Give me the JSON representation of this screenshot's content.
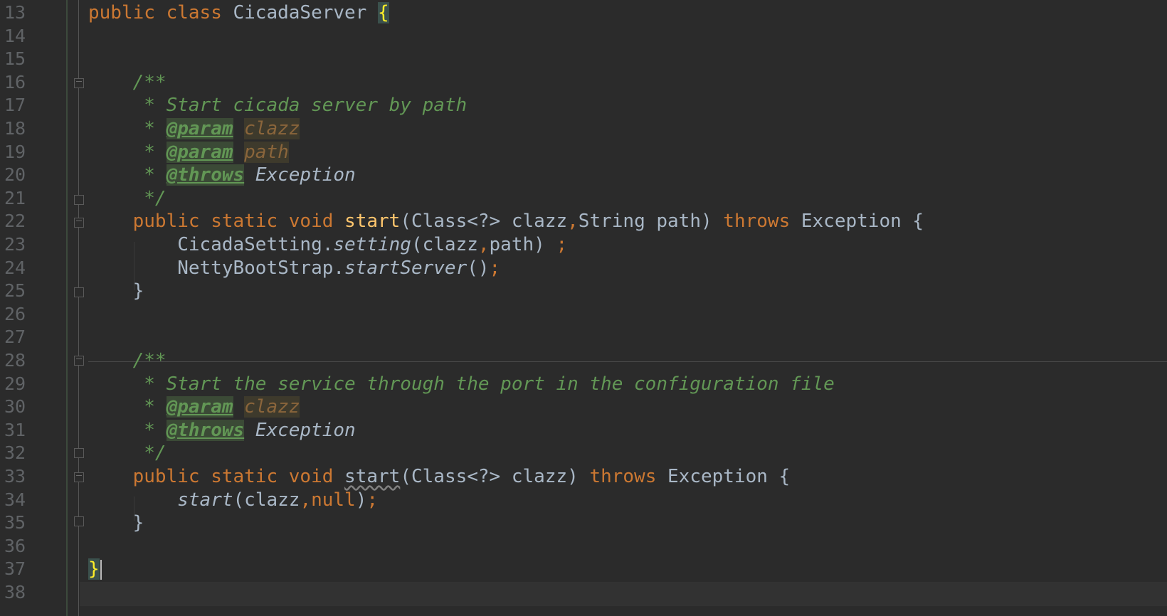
{
  "colors": {
    "background": "#2b2b2b",
    "keyword": "#cc7832",
    "plain": "#a9b7c6",
    "function_decl": "#ffc66d",
    "doc_comment": "#629755",
    "line_number": "#606366"
  },
  "editor": {
    "lines": [
      {
        "num": "13",
        "tokens": [
          {
            "t": "public ",
            "c": "kw"
          },
          {
            "t": "class ",
            "c": "kw"
          },
          {
            "t": "CicadaServer ",
            "c": "cls"
          },
          {
            "t": "{",
            "c": "brace-hl"
          }
        ]
      },
      {
        "num": "14",
        "tokens": []
      },
      {
        "num": "15",
        "tokens": []
      },
      {
        "num": "16",
        "tokens": [
          {
            "t": "    /**",
            "c": "doc"
          }
        ]
      },
      {
        "num": "17",
        "tokens": [
          {
            "t": "     * Start cicada server by path",
            "c": "doc"
          }
        ]
      },
      {
        "num": "18",
        "tokens": [
          {
            "t": "     * ",
            "c": "doc"
          },
          {
            "t": "@param",
            "c": "doctag"
          },
          {
            "t": " ",
            "c": "doc"
          },
          {
            "t": "clazz",
            "c": "docparam"
          }
        ]
      },
      {
        "num": "19",
        "tokens": [
          {
            "t": "     * ",
            "c": "doc"
          },
          {
            "t": "@param",
            "c": "doctag"
          },
          {
            "t": " ",
            "c": "doc"
          },
          {
            "t": "path",
            "c": "docparam"
          }
        ]
      },
      {
        "num": "20",
        "tokens": [
          {
            "t": "     * ",
            "c": "doc"
          },
          {
            "t": "@throws",
            "c": "doctag"
          },
          {
            "t": " ",
            "c": "doc"
          },
          {
            "t": "Exception",
            "c": "docref"
          }
        ]
      },
      {
        "num": "21",
        "tokens": [
          {
            "t": "     */",
            "c": "doc"
          }
        ]
      },
      {
        "num": "22",
        "tokens": [
          {
            "t": "    public ",
            "c": "kw"
          },
          {
            "t": "static ",
            "c": "kw"
          },
          {
            "t": "void ",
            "c": "kw"
          },
          {
            "t": "start",
            "c": "fn"
          },
          {
            "t": "(Class<?> clazz",
            "c": "plain"
          },
          {
            "t": ",",
            "c": "kw"
          },
          {
            "t": "String path) ",
            "c": "plain"
          },
          {
            "t": "throws ",
            "c": "kw"
          },
          {
            "t": "Exception {",
            "c": "plain"
          }
        ]
      },
      {
        "num": "23",
        "tokens": [
          {
            "t": "        CicadaSetting.",
            "c": "plain"
          },
          {
            "t": "setting",
            "c": "static-call"
          },
          {
            "t": "(clazz",
            "c": "plain"
          },
          {
            "t": ",",
            "c": "kw"
          },
          {
            "t": "path) ",
            "c": "plain"
          },
          {
            "t": ";",
            "c": "kw"
          }
        ]
      },
      {
        "num": "24",
        "tokens": [
          {
            "t": "        NettyBootStrap.",
            "c": "plain"
          },
          {
            "t": "startServer",
            "c": "static-call"
          },
          {
            "t": "()",
            "c": "plain"
          },
          {
            "t": ";",
            "c": "kw"
          }
        ]
      },
      {
        "num": "25",
        "tokens": [
          {
            "t": "    }",
            "c": "plain"
          }
        ]
      },
      {
        "num": "26",
        "tokens": []
      },
      {
        "num": "27",
        "tokens": []
      },
      {
        "num": "28",
        "tokens": [
          {
            "t": "    /**",
            "c": "doc"
          }
        ]
      },
      {
        "num": "29",
        "tokens": [
          {
            "t": "     * Start the service through the port in the configuration file",
            "c": "doc"
          }
        ]
      },
      {
        "num": "30",
        "tokens": [
          {
            "t": "     * ",
            "c": "doc"
          },
          {
            "t": "@param",
            "c": "doctag"
          },
          {
            "t": " ",
            "c": "doc"
          },
          {
            "t": "clazz",
            "c": "docparam"
          }
        ]
      },
      {
        "num": "31",
        "tokens": [
          {
            "t": "     * ",
            "c": "doc"
          },
          {
            "t": "@throws",
            "c": "doctag"
          },
          {
            "t": " ",
            "c": "doc"
          },
          {
            "t": "Exception",
            "c": "docref"
          }
        ]
      },
      {
        "num": "32",
        "tokens": [
          {
            "t": "     */",
            "c": "doc"
          }
        ]
      },
      {
        "num": "33",
        "tokens": [
          {
            "t": "    public ",
            "c": "kw"
          },
          {
            "t": "static ",
            "c": "kw"
          },
          {
            "t": "void ",
            "c": "kw"
          },
          {
            "t": "start",
            "c": "plain unused"
          },
          {
            "t": "(Class<?> clazz) ",
            "c": "plain"
          },
          {
            "t": "throws ",
            "c": "kw"
          },
          {
            "t": "Exception {",
            "c": "plain"
          }
        ]
      },
      {
        "num": "34",
        "tokens": [
          {
            "t": "        ",
            "c": "plain"
          },
          {
            "t": "start",
            "c": "static-call"
          },
          {
            "t": "(clazz",
            "c": "plain"
          },
          {
            "t": ",",
            "c": "kw"
          },
          {
            "t": "null",
            "c": "kw"
          },
          {
            "t": ")",
            "c": "plain"
          },
          {
            "t": ";",
            "c": "kw"
          }
        ]
      },
      {
        "num": "35",
        "tokens": [
          {
            "t": "    }",
            "c": "plain"
          }
        ]
      },
      {
        "num": "36",
        "tokens": []
      },
      {
        "num": "37",
        "tokens": [
          {
            "t": "}",
            "c": "brace-hl"
          }
        ],
        "caret": true
      },
      {
        "num": "38",
        "tokens": []
      }
    ]
  }
}
